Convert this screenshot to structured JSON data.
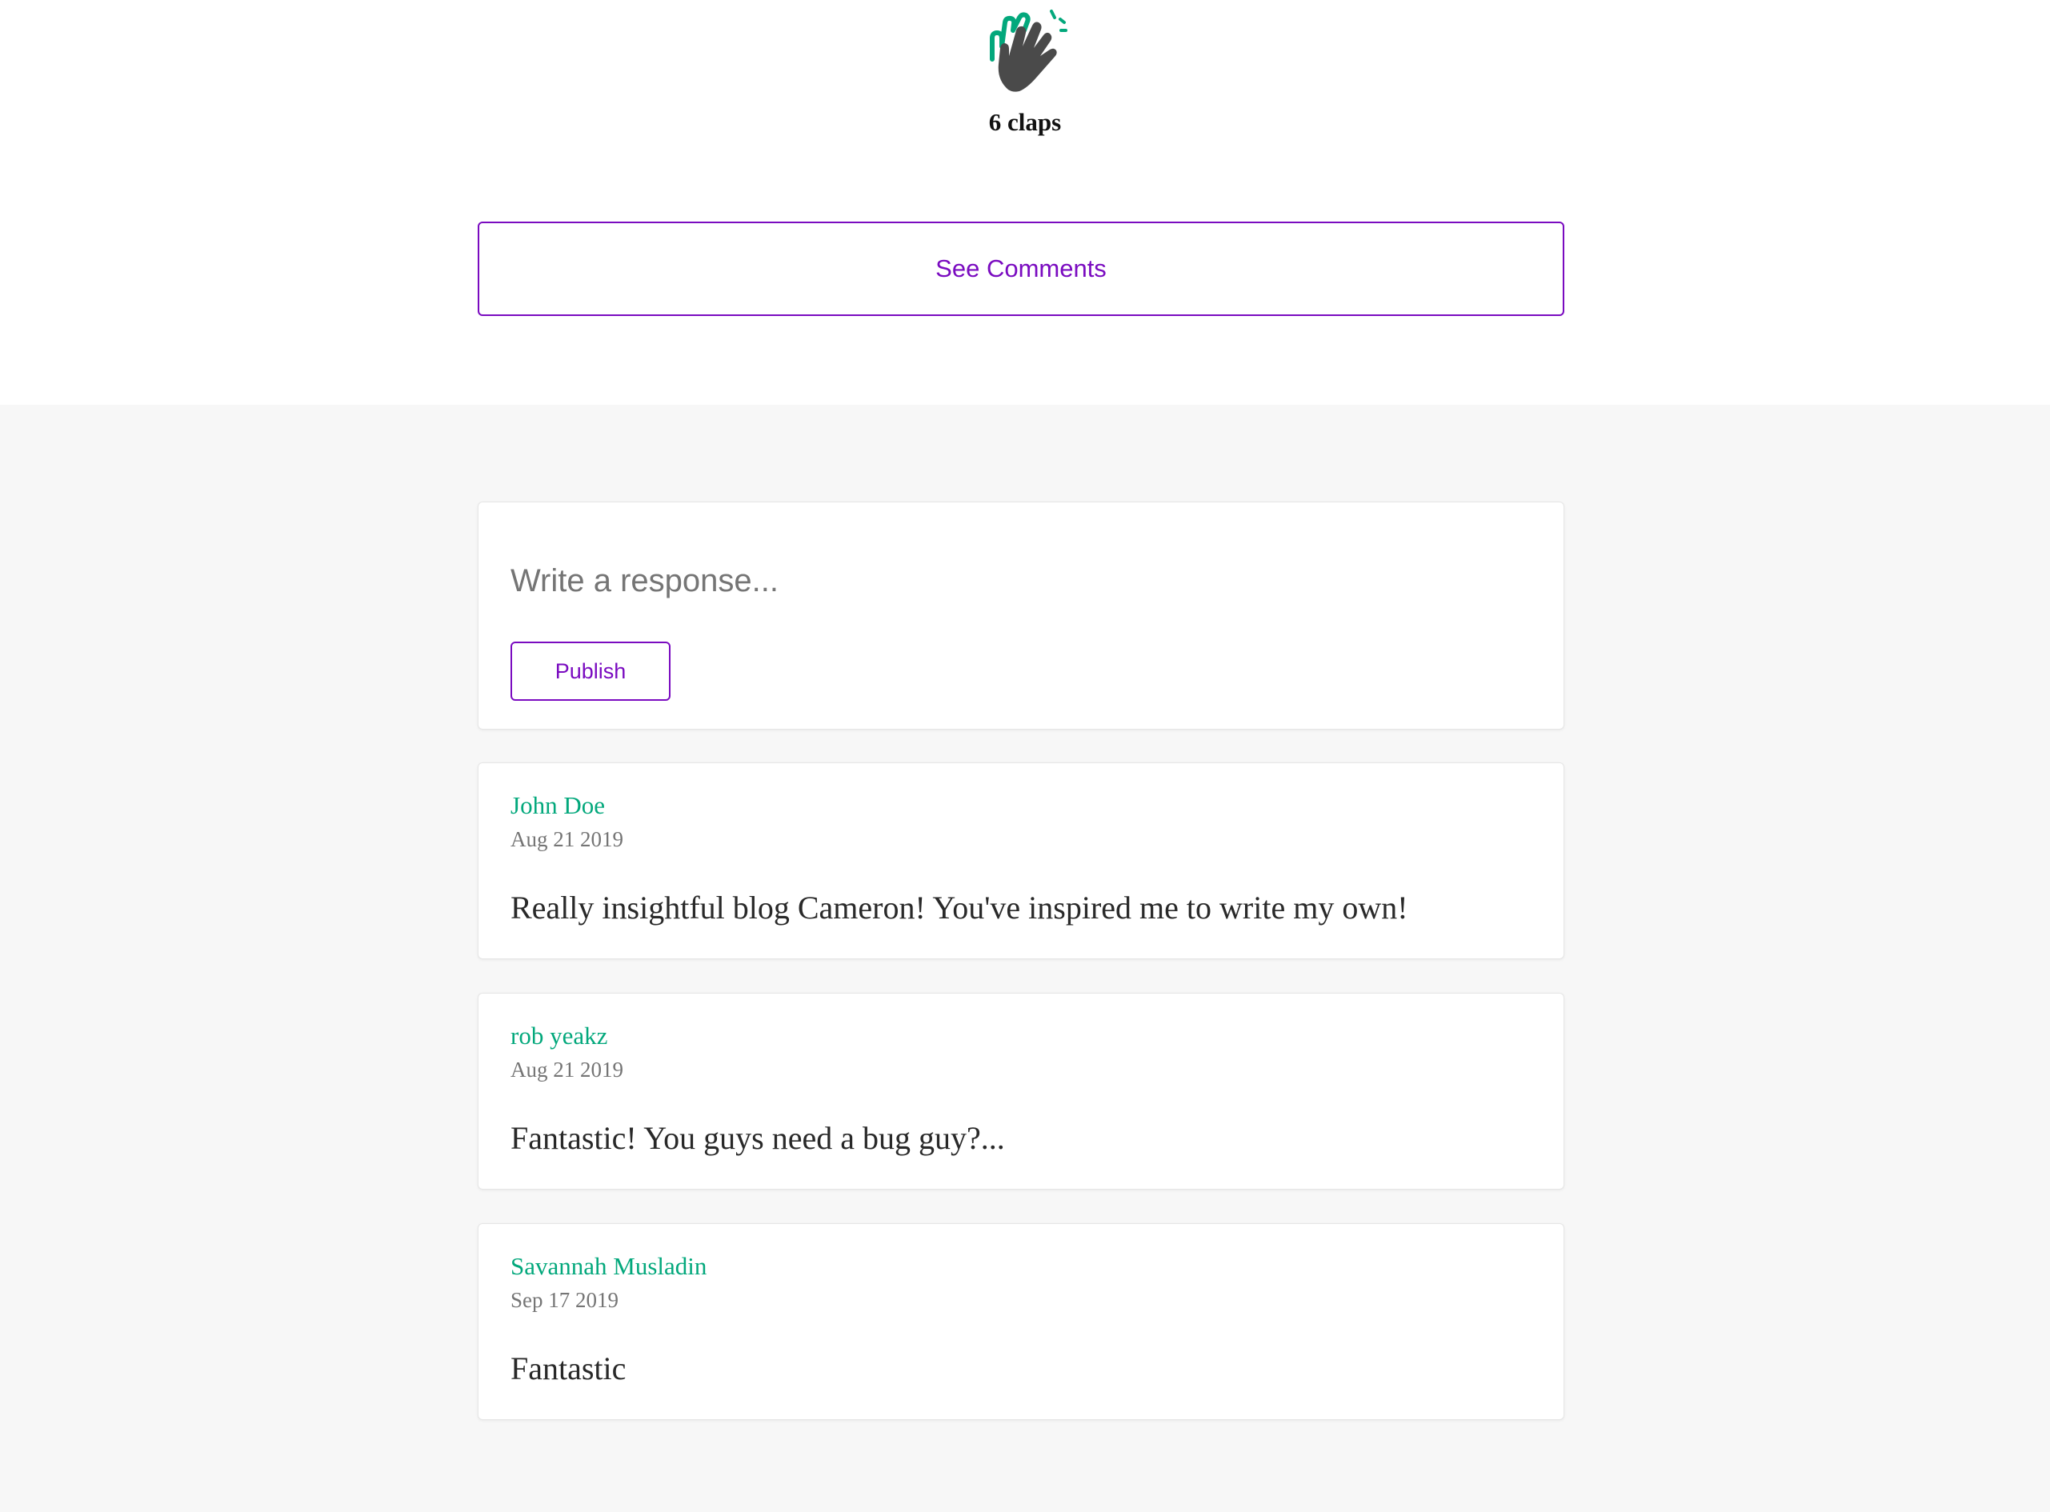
{
  "claps": {
    "icon": "clap-hands-icon",
    "count_label": "6 claps"
  },
  "see_comments_label": "See Comments",
  "response": {
    "placeholder": "Write a response...",
    "publish_label": "Publish"
  },
  "comments": [
    {
      "author": "John Doe",
      "date": "Aug 21 2019",
      "body": "Really insightful blog Cameron! You've inspired me to write my own!"
    },
    {
      "author": "rob yeakz",
      "date": "Aug 21 2019",
      "body": "Fantastic! You guys need a bug guy?..."
    },
    {
      "author": "Savannah Musladin",
      "date": "Sep 17 2019",
      "body": "Fantastic"
    }
  ],
  "colors": {
    "accent": "#7a0bc0",
    "author": "#03a87c",
    "comments_background": "#f7f7f7"
  }
}
